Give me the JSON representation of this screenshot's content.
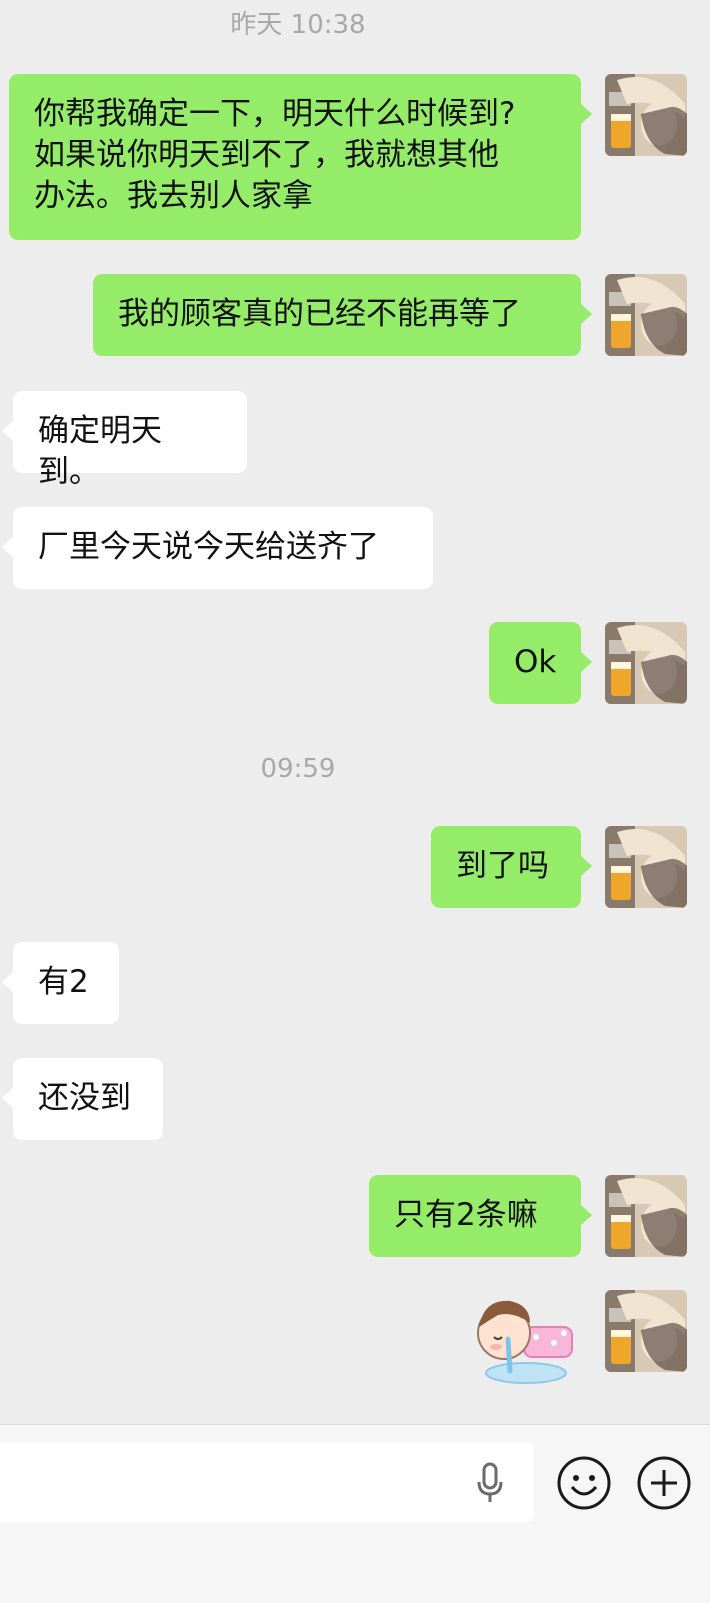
{
  "chat": {
    "timestamps": [
      "昨天 10:38",
      "09:59"
    ],
    "messages": [
      {
        "from": "me",
        "text": "你帮我确定一下，明天什么时候到?\n如果说你明天到不了，我就想其他\n办法。我去别人家拿"
      },
      {
        "from": "me",
        "text": "我的顾客真的已经不能再等了"
      },
      {
        "from": "them",
        "text": "确定明天到。"
      },
      {
        "from": "them",
        "text": "厂里今天说今天给送齐了"
      },
      {
        "from": "me",
        "text": "Ok"
      },
      {
        "from": "me",
        "text": "到了吗"
      },
      {
        "from": "them",
        "text": "有2"
      },
      {
        "from": "them",
        "text": "还没到"
      },
      {
        "from": "me",
        "text": "只有2条嘛"
      }
    ],
    "sticker": {
      "from": "me",
      "icon": "crying-girl-sticker"
    }
  },
  "input_bar": {
    "text": "",
    "icons": [
      "microphone-icon",
      "emoji-icon",
      "plus-icon"
    ]
  },
  "colors": {
    "background": "#ededed",
    "outgoing_bubble": "#95ec69",
    "incoming_bubble": "#ffffff",
    "timestamp_text": "#a8a8a8"
  }
}
